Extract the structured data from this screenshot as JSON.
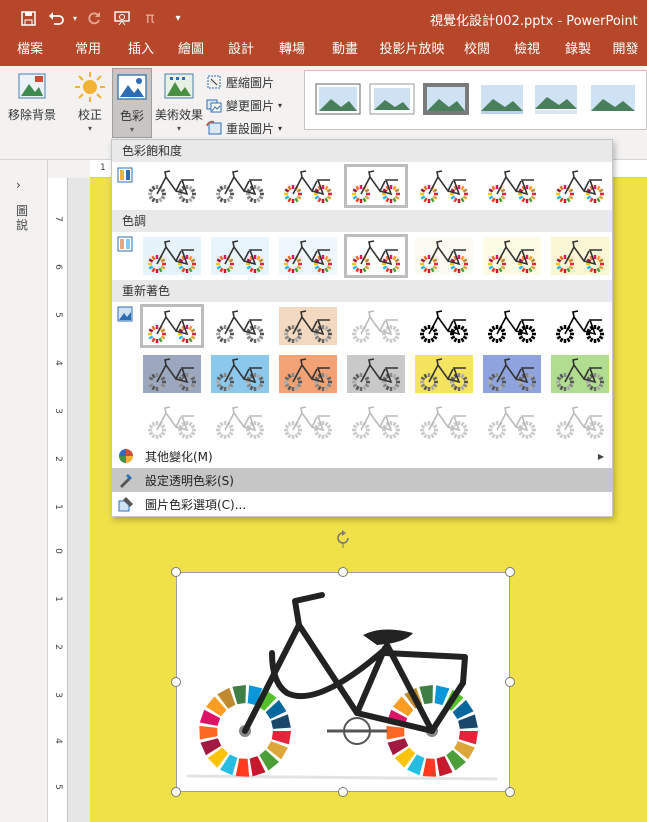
{
  "window": {
    "title": "視覺化設計002.pptx  -  PowerPoint"
  },
  "qat": {
    "save": "save-icon",
    "undo": "undo-icon",
    "redo": "redo-icon",
    "present": "present-from-start-icon",
    "equation": "π",
    "customize": "▾"
  },
  "tabs": [
    "檔案",
    "常用",
    "插入",
    "繪圖",
    "設計",
    "轉場",
    "動畫",
    "投影片放映",
    "校閱",
    "檢視",
    "錄製",
    "開發"
  ],
  "ribbon": {
    "remove_bg": "移除背景",
    "corrections": "校正",
    "color": "色彩",
    "artistic": "美術效果",
    "compress": "壓縮圖片",
    "change": "變更圖片",
    "reset": "重設圖片"
  },
  "left_pane": {
    "collapse": "›",
    "label": "圖說"
  },
  "ruler": {
    "vertical_ticks": [
      "7",
      "6",
      "5",
      "4",
      "3",
      "2",
      "1",
      "0",
      "1",
      "2",
      "3",
      "4",
      "5"
    ],
    "horizontal_start": "1"
  },
  "menu": {
    "saturation_header": "色彩飽和度",
    "tone_header": "色調",
    "recolor_header": "重新著色",
    "more_variations": "其他變化(M)",
    "set_transparent": "設定透明色彩(S)",
    "color_options": "圖片色彩選項(C)...",
    "saturation_selected": 3,
    "tone_selected": 3,
    "recolor_selected": 0,
    "tone_tints": [
      "#e6f3fb",
      "#e9f5fc",
      "#eef7fc",
      "#ffffff",
      "#fbfbf1",
      "#fcfbe3",
      "#fbf7d4"
    ],
    "recolor_row1": [
      "#ffffff",
      "#ffffff",
      "#f3d9bf",
      "#ffffff",
      "#ffffff",
      "#ffffff",
      "#ffffff"
    ],
    "recolor_row2": [
      "#9aa7bf",
      "#8cc7ec",
      "#f2a274",
      "#c9c9c9",
      "#f5e45f",
      "#8fa4df",
      "#b0dd8f"
    ],
    "recolor_row3": [
      "#ffffff",
      "#ffffff",
      "#ffffff",
      "#ffffff",
      "#ffffff",
      "#ffffff",
      "#ffffff"
    ]
  },
  "colors": {
    "accent": "#b7472a",
    "slide_bg": "#f0e148"
  }
}
